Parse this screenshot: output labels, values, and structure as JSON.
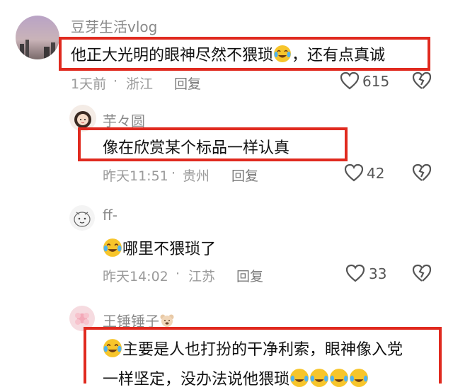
{
  "accent_color": "#e02a1f",
  "comments": [
    {
      "username": "豆芽生活vlog",
      "text": "他正大光明的眼神尽然不猥琐",
      "text_after_emoji": "，还有点真诚",
      "emoji": "laughing-crying-emoji",
      "time": "1天前",
      "location": "浙江",
      "reply_label": "回复",
      "likes": "615"
    },
    {
      "username": "芋々圆",
      "text": "像在欣赏某个标品一样认真",
      "time": "昨天11:51",
      "location": "贵州",
      "reply_label": "回复",
      "likes": "42"
    },
    {
      "username": "ff-",
      "text": "哪里不猥琐了",
      "emoji": "laughing-crying-emoji",
      "time": "昨天14:02",
      "location": "江苏",
      "reply_label": "回复",
      "likes": "33"
    },
    {
      "username": "王锤锤子",
      "text_line1": "主要是人也打扮的干净利索，眼神像入党",
      "text_line2": "一样坚定，没办法说他猥琐",
      "emoji": "laughing-crying-emoji"
    }
  ],
  "separator": "·"
}
